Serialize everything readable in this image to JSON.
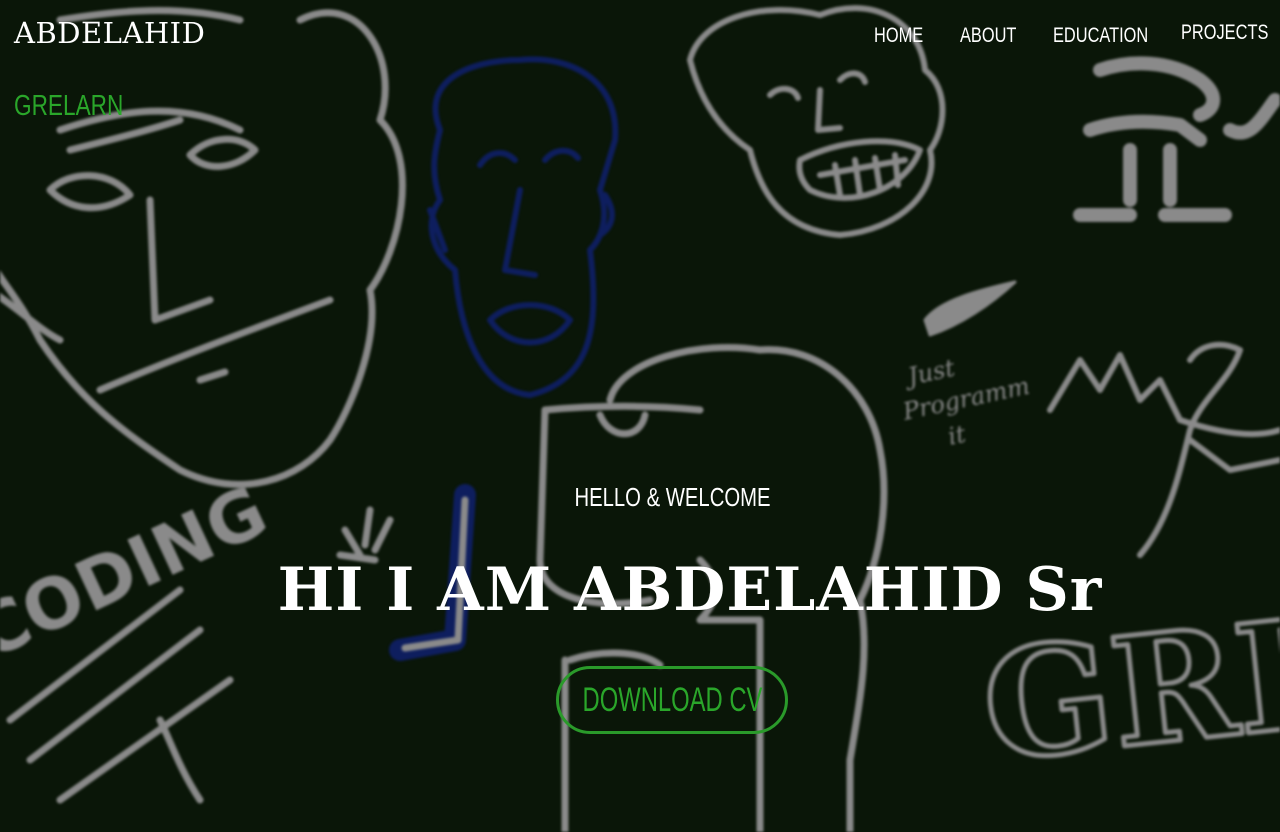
{
  "header": {
    "brand": "ABDELAHID",
    "sub_brand": "GRELARN"
  },
  "nav": {
    "items": [
      {
        "label": "HOME"
      },
      {
        "label": "ABOUT"
      },
      {
        "label": "EDUCATION"
      },
      {
        "label": "PROJECTS"
      }
    ]
  },
  "hero": {
    "kicker": "HELLO & WELCOME",
    "title": "HI I AM ABDELAHID Sr",
    "cta_label": "DOWNLOAD CV"
  },
  "background": {
    "doodle_texts": [
      "Just",
      "Programm",
      "it",
      "CODING",
      "GREL"
    ]
  },
  "colors": {
    "background": "#0a1608",
    "doodle": "#8a8a8a",
    "doodle_blue": "#0e1e5e",
    "accent": "#2aa62a"
  }
}
